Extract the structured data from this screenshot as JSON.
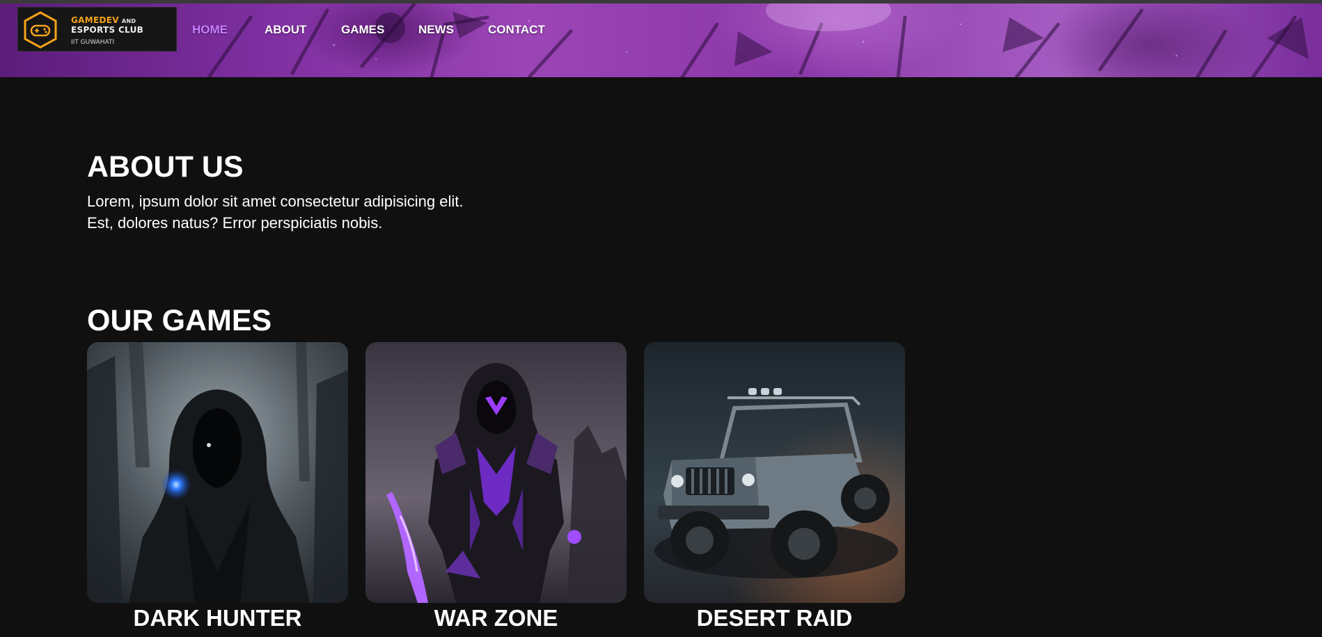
{
  "brand": {
    "line1": "GAMEDEV",
    "line1_suffix": "AND",
    "line2": "ESPORTS CLUB",
    "line3": "IIT GUWAHATI",
    "accent": "#f5a31a"
  },
  "nav": {
    "items": [
      "HOME",
      "ABOUT",
      "GAMES",
      "NEWS",
      "CONTACT"
    ],
    "active": "HOME",
    "active_color": "#c77dff"
  },
  "about": {
    "title": "ABOUT US",
    "line1": "Lorem, ipsum dolor sit amet consectetur adipisicing elit.",
    "line2": "Est, dolores natus? Error perspiciatis nobis."
  },
  "games": {
    "title": "OUR GAMES",
    "items": [
      {
        "title": "DARK HUNTER",
        "image": "hooded-figure-blue-eye"
      },
      {
        "title": "WAR ZONE",
        "image": "purple-armored-warrior"
      },
      {
        "title": "DESERT RAID",
        "image": "offroad-jeep"
      }
    ]
  },
  "colors": {
    "page_background": "#101010",
    "header_purple": "#9b45b6"
  }
}
